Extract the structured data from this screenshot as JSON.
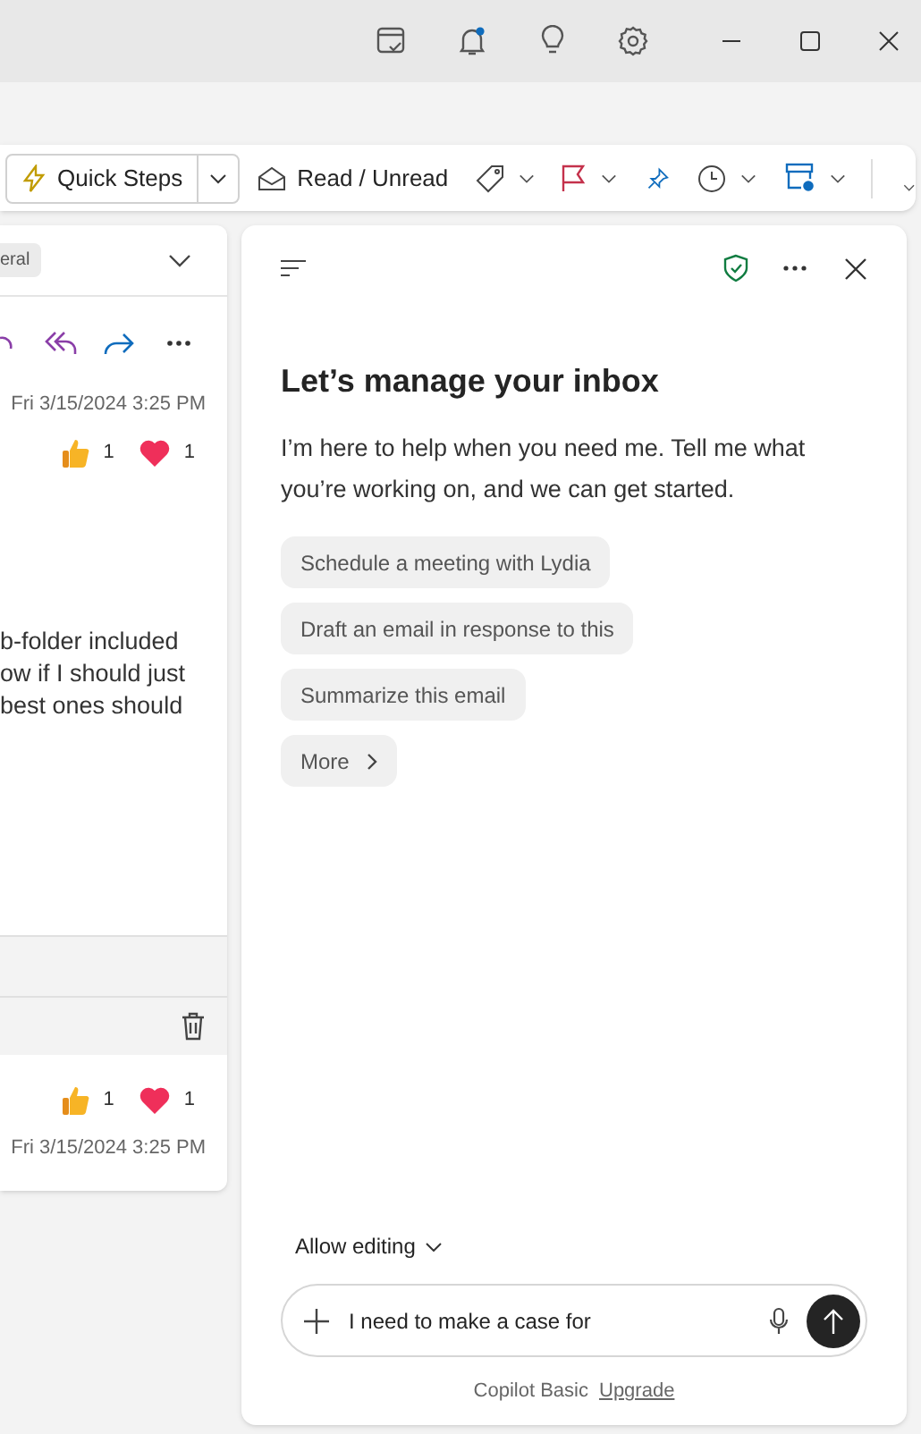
{
  "toolbar": {
    "quick_steps": "Quick Steps",
    "read_unread": "Read / Unread"
  },
  "reading_pane": {
    "tag": "eral",
    "message_date": "Fri 3/15/2024 3:25 PM",
    "reactions": [
      {
        "kind": "thumbs",
        "count": "1"
      },
      {
        "kind": "heart",
        "count": "1"
      }
    ],
    "body_lines": [
      "b-folder included",
      "ow if I should just",
      "best ones should"
    ],
    "reply": {
      "reactions": [
        {
          "kind": "thumbs",
          "count": "1"
        },
        {
          "kind": "heart",
          "count": "1"
        }
      ],
      "date": "Fri 3/15/2024 3:25 PM"
    }
  },
  "copilot": {
    "heading": "Let’s manage your inbox",
    "intro": "I’m here to help when you need me. Tell me what you’re working on, and we can get started.",
    "suggestions": [
      {
        "kind": "prompt",
        "label": "Schedule a meeting with Lydia"
      },
      {
        "kind": "prompt",
        "label": "Draft an email in response to this"
      },
      {
        "kind": "prompt",
        "label": "Summarize this email"
      },
      {
        "kind": "more",
        "label": "More"
      }
    ],
    "allow_editing": "Allow editing",
    "input": {
      "value": "I need to make a case for"
    },
    "plan": "Copilot Basic",
    "upgrade": "Upgrade"
  }
}
